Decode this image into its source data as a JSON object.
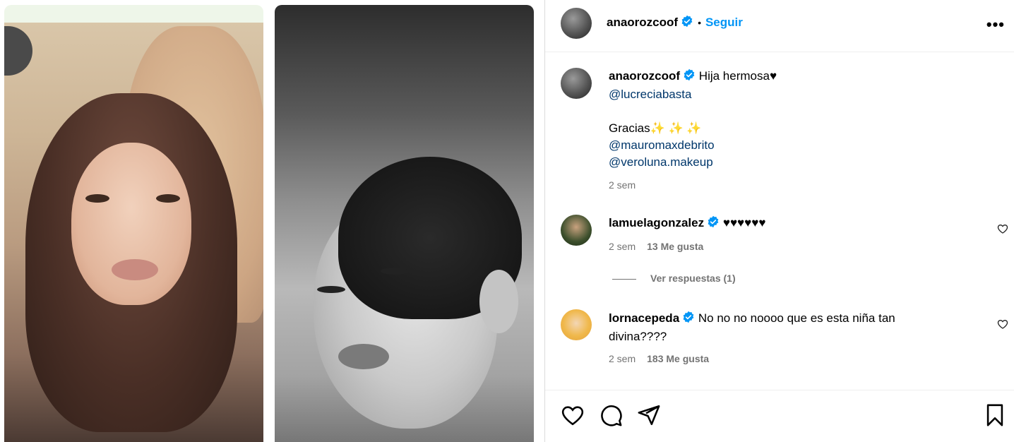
{
  "post": {
    "owner": {
      "username": "anaorozcoof",
      "separator": "•",
      "follow_label": "Seguir",
      "more_icon": "more-horizontal-icon"
    },
    "caption": {
      "username": "anaorozcoof",
      "text": "Hija hermosa♥",
      "mention_1": "@lucreciabasta",
      "thanks": "Gracias✨ ✨ ✨",
      "mention_2": "@mauromaxdebrito",
      "mention_3": "@veroluna.makeup",
      "time": "2 sem"
    },
    "comments": [
      {
        "username": "lamuelagonzalez",
        "text": "♥♥♥♥♥♥",
        "time": "2 sem",
        "likes": "13 Me gusta",
        "replies": "Ver respuestas (1)"
      },
      {
        "username": "lornacepeda",
        "text": "No no no noooo que es esta niña tan divina????",
        "time": "2 sem",
        "likes": "183 Me gusta"
      }
    ]
  },
  "colors": {
    "accent": "#0095f6",
    "mention": "#00376b",
    "muted": "#737373",
    "verified": "#0095f6"
  }
}
